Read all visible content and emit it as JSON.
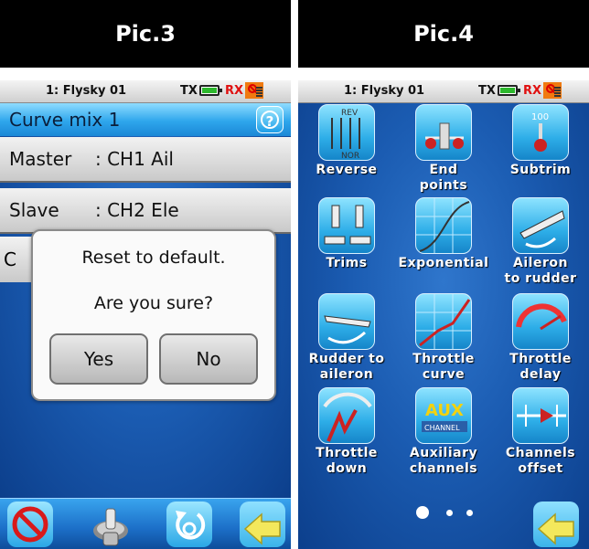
{
  "left": {
    "header": "Pic.3",
    "status": {
      "model": "1: Flysky 01",
      "tx": "TX",
      "rx": "RX"
    },
    "title": "Curve mix 1",
    "rows": [
      {
        "key": "Master",
        "value": ": CH1 Ail"
      },
      {
        "key": "Slave",
        "value": ": CH2 Ele"
      }
    ],
    "row3_partial": "C",
    "dialog": {
      "message": "Reset to default.",
      "question": "Are you sure?",
      "yes": "Yes",
      "no": "No"
    },
    "toolbar": [
      "disable-icon",
      "switch-icon",
      "reset-icon",
      "back-icon"
    ]
  },
  "right": {
    "header": "Pic.4",
    "status": {
      "model": "1: Flysky 01",
      "tx": "TX",
      "rx": "RX"
    },
    "icon_texts": {
      "rev": "REV",
      "nor": "NOR",
      "subtrim": "100",
      "aux1": "AUX",
      "aux2": "CHANNEL"
    },
    "items": [
      {
        "l1": "Reverse",
        "l2": ""
      },
      {
        "l1": "End",
        "l2": "points"
      },
      {
        "l1": "Subtrim",
        "l2": ""
      },
      {
        "l1": "Trims",
        "l2": ""
      },
      {
        "l1": "Exponential",
        "l2": ""
      },
      {
        "l1": "Aileron",
        "l2": "to rudder"
      },
      {
        "l1": "Rudder to",
        "l2": "aileron"
      },
      {
        "l1": "Throttle",
        "l2": "curve"
      },
      {
        "l1": "Throttle",
        "l2": "delay"
      },
      {
        "l1": "Throttle",
        "l2": "down"
      },
      {
        "l1": "Auxiliary",
        "l2": "channels"
      },
      {
        "l1": "Channels",
        "l2": "offset"
      }
    ],
    "page_indicator": {
      "pages": 3,
      "current": 1
    }
  }
}
